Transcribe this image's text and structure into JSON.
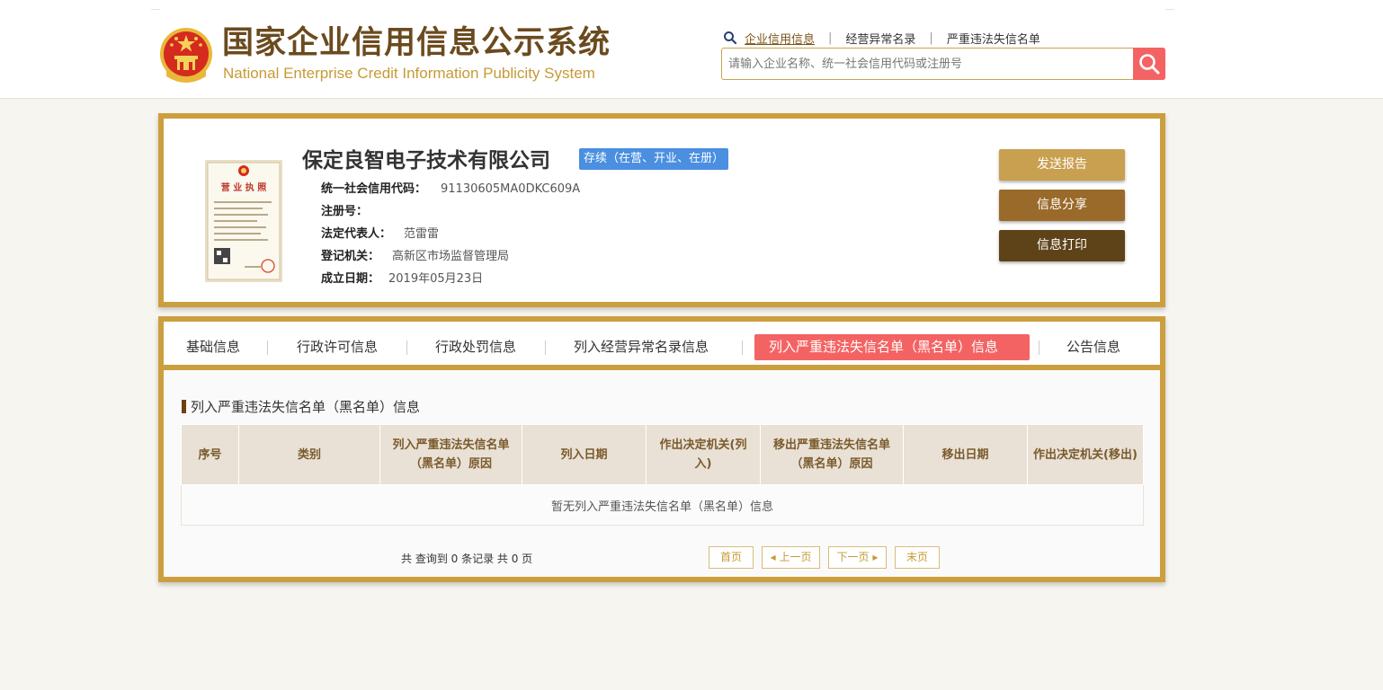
{
  "header": {
    "logo_cn": "国家企业信用信息公示系统",
    "logo_en": "National Enterprise Credit Information Publicity System",
    "nav": [
      "企业信用信息",
      "经营异常名录",
      "严重违法失信名单"
    ],
    "nav_separator": "|",
    "search_placeholder": "请输入企业名称、统一社会信用代码或注册号",
    "icons": {
      "emblem": "national-emblem-icon",
      "nav": "search-icon",
      "search_button": "search-icon"
    }
  },
  "company": {
    "name": "保定良智电子技术有限公司",
    "status": "存续（在营、开业、在册）",
    "fields": [
      {
        "label": "统一社会信用代码：",
        "value": "91130605MA0DKC609A"
      },
      {
        "label": "注册号：",
        "value": ""
      },
      {
        "label": "法定代表人：",
        "value": "范雷雷"
      },
      {
        "label": "登记机关：",
        "value": "高新区市场监督管理局"
      },
      {
        "label": "成立日期：",
        "value": "2019年05月23日"
      }
    ],
    "license_title": "营 业 执 照",
    "buttons": {
      "send_report": "发送报告",
      "share": "信息分享",
      "print": "信息打印"
    }
  },
  "tabs": [
    "基础信息",
    "行政许可信息",
    "行政处罚信息",
    "列入经营异常名录信息",
    "列入严重违法失信名单（黑名单）信息",
    "公告信息"
  ],
  "active_tab_index": 4,
  "section": {
    "title": "列入严重违法失信名单（黑名单）信息",
    "table": {
      "headers": [
        "序号",
        "类别",
        "列入严重违法失信名单（黑名单）原因",
        "列入日期",
        "作出决定机关(列入)",
        "移出严重违法失信名单（黑名单）原因",
        "移出日期",
        "作出决定机关(移出)"
      ],
      "empty_text": "暂无列入严重违法失信名单（黑名单）信息"
    }
  },
  "pagination": {
    "summary": "共 查询到 0 条记录 共 0 页",
    "first": "首页",
    "prev": "上一页",
    "next": "下一页",
    "last": "末页"
  },
  "colors": {
    "gold_border": "#cc9f3e",
    "brown_text": "#6b4a1e",
    "logo_en": "#c79a36",
    "status_badge": "#4a8fe0",
    "active_tab": "#f46363",
    "search_button": "#f46363",
    "btn_send_report": "#c9a050",
    "btn_share": "#9a6a2a",
    "btn_print": "#5e4218"
  }
}
